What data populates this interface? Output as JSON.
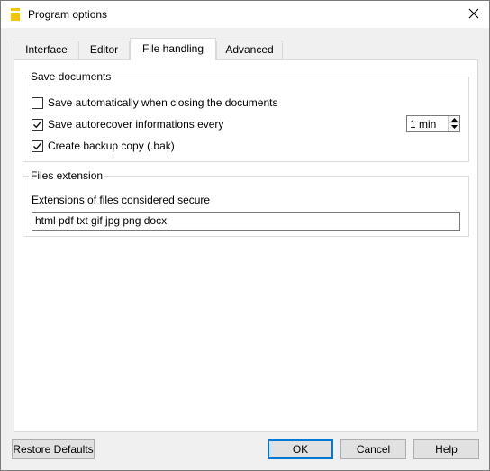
{
  "window": {
    "title": "Program options"
  },
  "tabs": [
    {
      "label": "Interface",
      "active": false
    },
    {
      "label": "Editor",
      "active": false
    },
    {
      "label": "File handling",
      "active": true
    },
    {
      "label": "Advanced",
      "active": false
    }
  ],
  "save_documents": {
    "title": "Save documents",
    "save_on_close": {
      "label": "Save automatically when closing the documents",
      "checked": false
    },
    "autorecover": {
      "label": "Save autorecover informations every",
      "checked": true,
      "interval": "1 min"
    },
    "backup": {
      "label": "Create backup copy (.bak)",
      "checked": true
    }
  },
  "files_extension": {
    "title": "Files extension",
    "field_label": "Extensions of files considered secure",
    "value": "html pdf txt gif jpg png docx"
  },
  "buttons": {
    "restore": "Restore Defaults",
    "ok": "OK",
    "cancel": "Cancel",
    "help": "Help"
  },
  "colors": {
    "accent": "#0078d7",
    "app_icon": "#f5c400",
    "dialog_bg": "#f0f0f0",
    "panel_bg": "#ffffff"
  },
  "icons": {
    "app": "banana-app-icon",
    "close": "close-icon",
    "check": "checkmark-icon",
    "spin_up": "caret-up-icon",
    "spin_down": "caret-down-icon"
  }
}
